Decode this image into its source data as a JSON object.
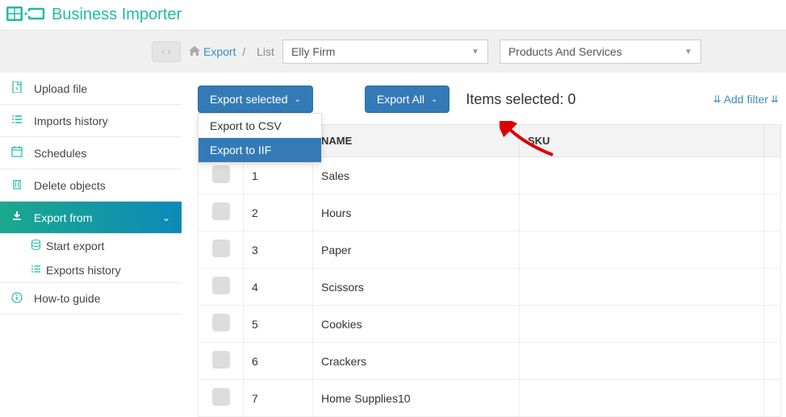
{
  "brand": {
    "title": "Business Importer"
  },
  "breadcrumb": {
    "link": "Export",
    "list_label": "List",
    "firm_selected": "Elly Firm",
    "type_selected": "Products And Services"
  },
  "sidebar": {
    "items": [
      {
        "label": "Upload file"
      },
      {
        "label": "Imports history"
      },
      {
        "label": "Schedules"
      },
      {
        "label": "Delete objects"
      },
      {
        "label": "Export from"
      },
      {
        "label": "How-to guide"
      }
    ],
    "sub": [
      {
        "label": "Start export"
      },
      {
        "label": "Exports history"
      }
    ]
  },
  "toolbar": {
    "export_selected": "Export selected",
    "export_all": "Export All",
    "items_selected_prefix": "Items selected: ",
    "items_selected_count": "0",
    "add_filter": "Add filter"
  },
  "dropdown": {
    "items": [
      {
        "label": "Export to CSV"
      },
      {
        "label": "Export to IIF"
      }
    ]
  },
  "table": {
    "headers": {
      "num": "#",
      "name": "NAME",
      "sku": "SKU"
    },
    "rows": [
      {
        "num": "1",
        "name": "Sales",
        "sku": ""
      },
      {
        "num": "2",
        "name": "Hours",
        "sku": ""
      },
      {
        "num": "3",
        "name": "Paper",
        "sku": ""
      },
      {
        "num": "4",
        "name": "Scissors",
        "sku": ""
      },
      {
        "num": "5",
        "name": "Cookies",
        "sku": ""
      },
      {
        "num": "6",
        "name": "Crackers",
        "sku": ""
      },
      {
        "num": "7",
        "name": "Home Supplies10",
        "sku": ""
      }
    ]
  }
}
